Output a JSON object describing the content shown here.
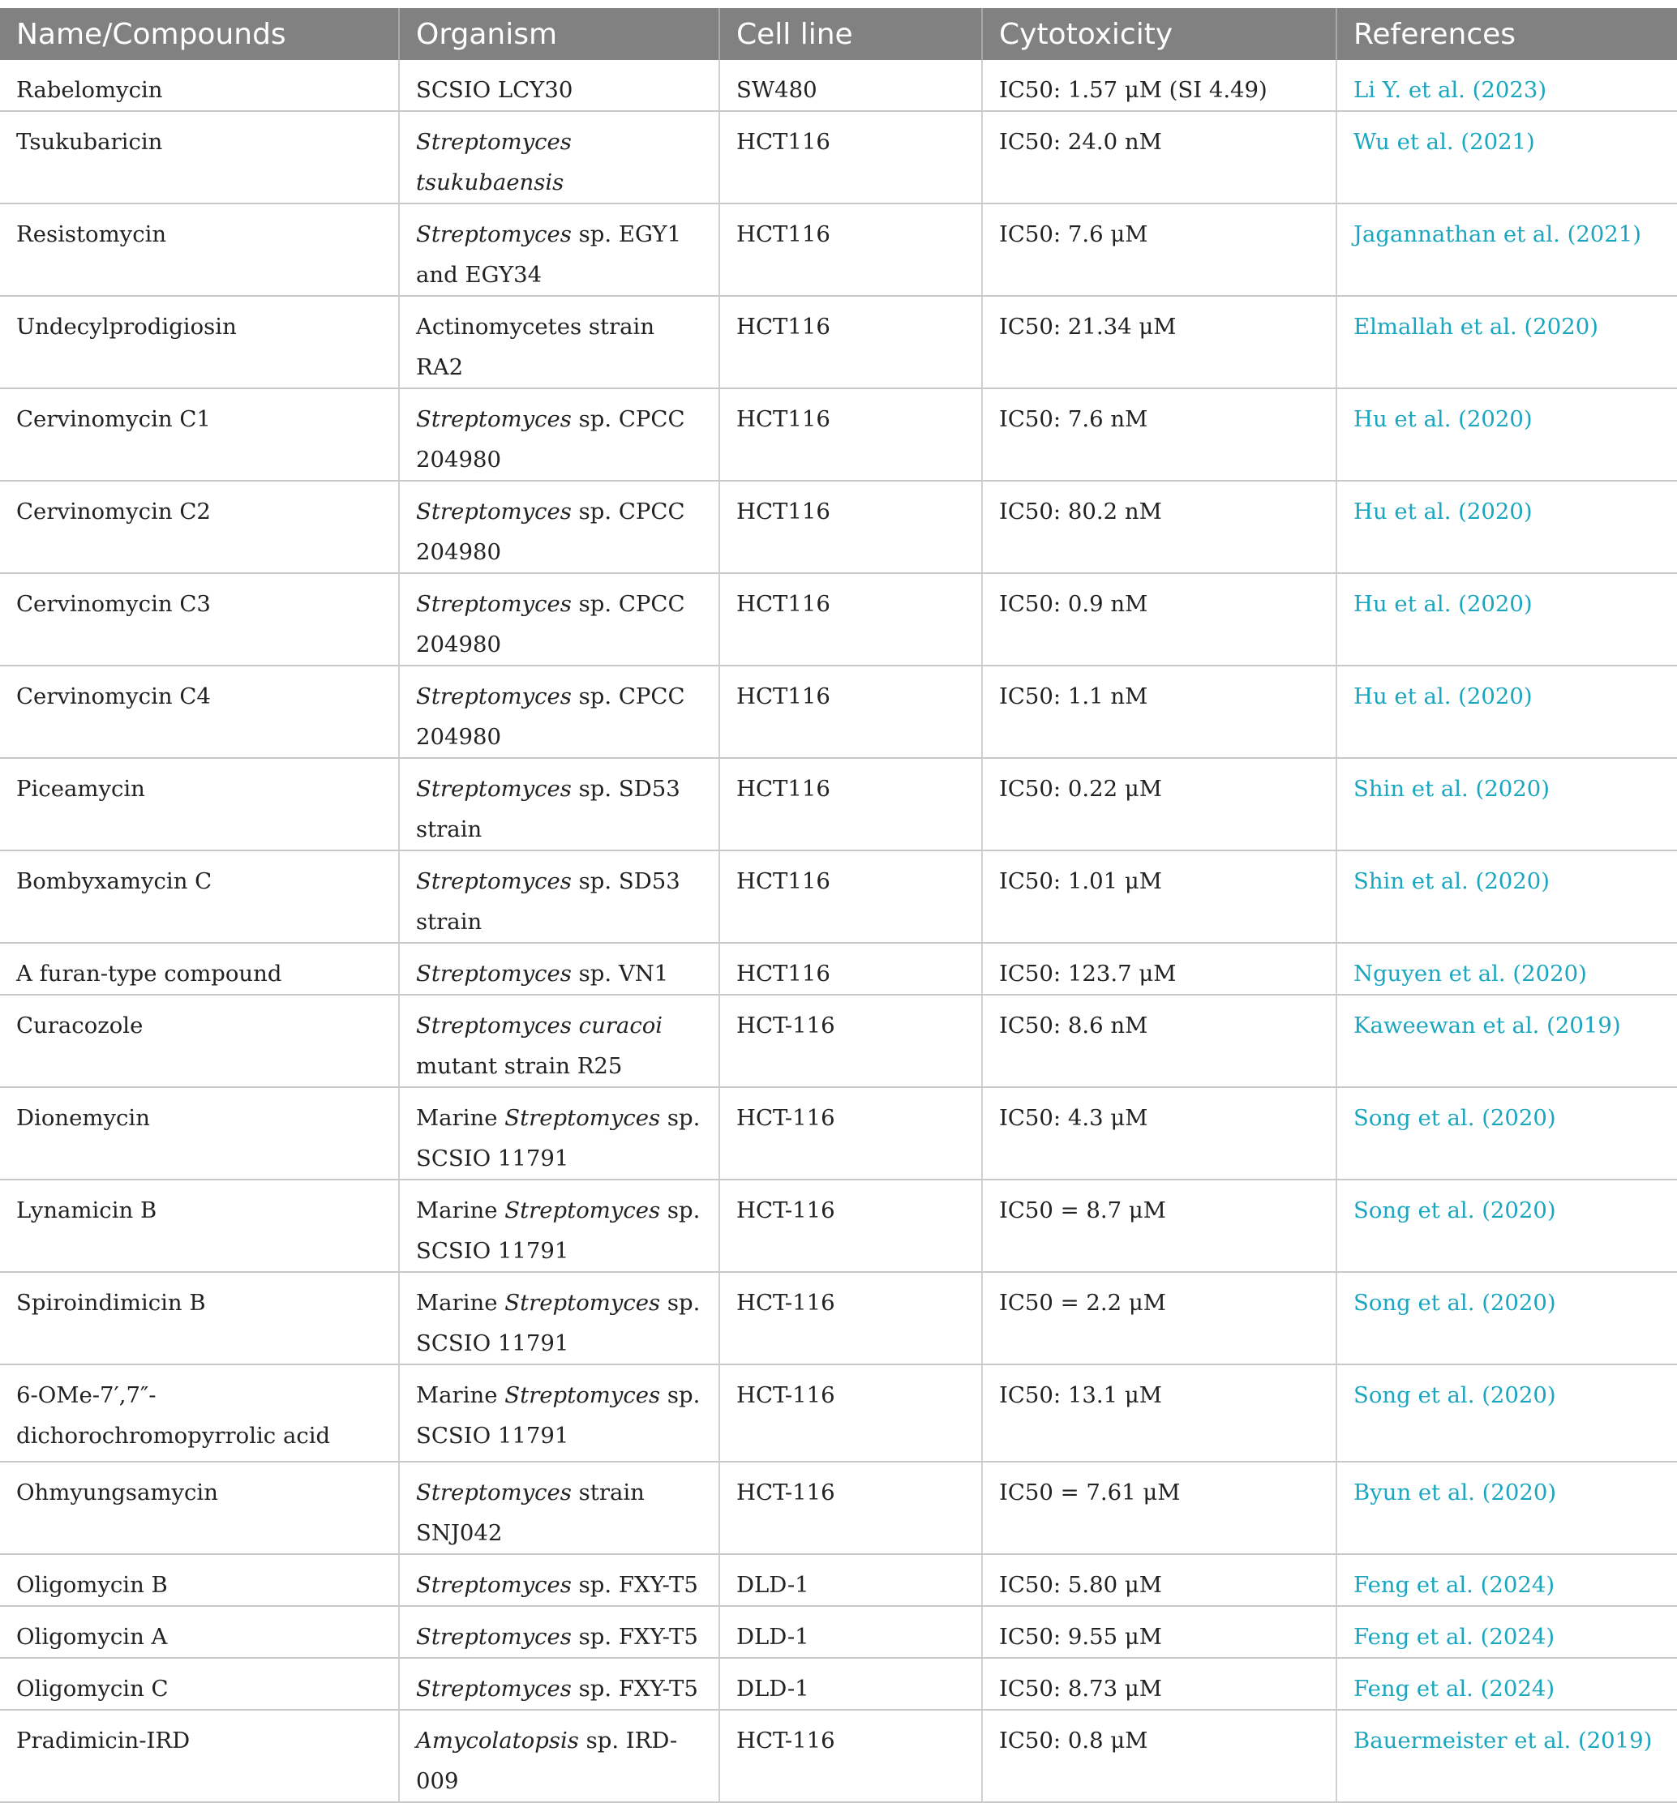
{
  "columns": [
    "Name/Compounds",
    "Organism",
    "Cell line",
    "Cytotoxicity",
    "References"
  ],
  "rows": [
    {
      "name": "Rabelomycin",
      "org_italic": "",
      "org_rest": "SCSIO LCY30",
      "cell": "SW480",
      "cyto": "IC50: 1.57 μM (SI 4.49)",
      "ref": "Li Y. et al. (2023)"
    },
    {
      "name": "Tsukubaricin",
      "org_italic": "Streptomyces tsukubaensis",
      "org_rest": "",
      "cell": "HCT116",
      "cyto": "IC50: 24.0 nM",
      "ref": "Wu et al. (2021)"
    },
    {
      "name": "Resistomycin",
      "org_italic": "Streptomyces",
      "org_rest": " sp. EGY1 and EGY34",
      "cell": "HCT116",
      "cyto": "IC50: 7.6 μM",
      "ref": "Jagannathan et al. (2021)"
    },
    {
      "name": "Undecylprodigiosin",
      "org_italic": "",
      "org_rest": "Actinomycetes strain RA2",
      "cell": "HCT116",
      "cyto": "IC50: 21.34 μM",
      "ref": "Elmallah et al. (2020)"
    },
    {
      "name": "Cervinomycin C1",
      "org_italic": "Streptomyces",
      "org_rest": " sp. CPCC 204980",
      "cell": "HCT116",
      "cyto": "IC50: 7.6 nM",
      "ref": "Hu et al. (2020)"
    },
    {
      "name": "Cervinomycin C2",
      "org_italic": "Streptomyces",
      "org_rest": " sp. CPCC 204980",
      "cell": "HCT116",
      "cyto": "IC50: 80.2 nM",
      "ref": "Hu et al. (2020)"
    },
    {
      "name": "Cervinomycin C3",
      "org_italic": "Streptomyces",
      "org_rest": " sp. CPCC 204980",
      "cell": "HCT116",
      "cyto": "IC50: 0.9 nM",
      "ref": "Hu et al. (2020)"
    },
    {
      "name": "Cervinomycin C4",
      "org_italic": "Streptomyces",
      "org_rest": " sp. CPCC 204980",
      "cell": "HCT116",
      "cyto": "IC50: 1.1 nM",
      "ref": "Hu et al. (2020)"
    },
    {
      "name": "Piceamycin",
      "org_italic": "Streptomyces",
      "org_rest": " sp. SD53 strain",
      "cell": "HCT116",
      "cyto": "IC50: 0.22 μM",
      "ref": "Shin et al. (2020)"
    },
    {
      "name": "Bombyxamycin C",
      "org_italic": "Streptomyces",
      "org_rest": " sp. SD53 strain",
      "cell": "HCT116",
      "cyto": "IC50: 1.01 μM",
      "ref": "Shin et al. (2020)"
    },
    {
      "name": "A furan-type compound",
      "org_italic": "Streptomyces",
      "org_rest": " sp. VN1",
      "cell": "HCT116",
      "cyto": "IC50: 123.7 μM",
      "ref": "Nguyen et al. (2020)"
    },
    {
      "name": "Curacozole",
      "org_italic": "Streptomyces curacoi",
      "org_rest": " mutant strain R25",
      "cell": "HCT-116",
      "cyto": "IC50: 8.6 nM",
      "ref": "Kaweewan et al. (2019)"
    },
    {
      "name": "Dionemycin",
      "org_pre": "Marine ",
      "org_italic": "Streptomyces",
      "org_rest": " sp. SCSIO 11791",
      "cell": "HCT-116",
      "cyto": "IC50: 4.3 μM",
      "ref": "Song et al. (2020)"
    },
    {
      "name": "Lynamicin B",
      "org_pre": "Marine ",
      "org_italic": "Streptomyces",
      "org_rest": " sp. SCSIO 11791",
      "cell": "HCT-116",
      "cyto": "IC50 = 8.7 μM",
      "ref": "Song et al. (2020)"
    },
    {
      "name": "Spiroindimicin B",
      "org_pre": "Marine ",
      "org_italic": "Streptomyces",
      "org_rest": " sp. SCSIO 11791",
      "cell": "HCT-116",
      "cyto": "IC50 = 2.2 μM",
      "ref": "Song et al. (2020)"
    },
    {
      "name": "6-OMe-7′,7″-dichorochromopyrrolic acid",
      "org_pre": "Marine ",
      "org_italic": "Streptomyces",
      "org_rest": " sp. SCSIO 11791",
      "cell": "HCT-116",
      "cyto": "IC50: 13.1 μM",
      "ref": "Song et al. (2020)"
    },
    {
      "name": "Ohmyungsamycin",
      "org_italic": "Streptomyces",
      "org_rest": " strain SNJ042",
      "cell": "HCT-116",
      "cyto": "IC50 = 7.61 μM",
      "ref": "Byun et al. (2020)"
    },
    {
      "name": "Oligomycin B",
      "org_italic": "Streptomyces",
      "org_rest": " sp. FXY-T5",
      "cell": "DLD-1",
      "cyto": "IC50: 5.80 μM",
      "ref": "Feng et al. (2024)"
    },
    {
      "name": "Oligomycin A",
      "org_italic": "Streptomyces",
      "org_rest": " sp. FXY-T5",
      "cell": "DLD-1",
      "cyto": "IC50: 9.55 μM",
      "ref": "Feng et al. (2024)"
    },
    {
      "name": "Oligomycin C",
      "org_italic": "Streptomyces",
      "org_rest": " sp. FXY-T5",
      "cell": "DLD-1",
      "cyto": "IC50: 8.73 μM",
      "ref": "Feng et al. (2024)"
    },
    {
      "name": "Pradimicin-IRD",
      "org_italic": "Amycolatopsis",
      "org_rest": " sp. IRD-009",
      "cell": "HCT-116",
      "cyto": "IC50: 0.8 μM",
      "ref": "Bauermeister et al. (2019)"
    }
  ]
}
